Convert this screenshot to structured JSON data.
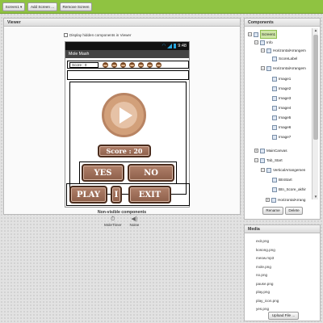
{
  "toolbar": {
    "screen_select": "Screen1 ▾",
    "add_screen": "Add Screen ...",
    "remove_screen": "Remove Screen"
  },
  "viewer": {
    "title": "Viewer",
    "checkbox_label": "Display hidden components in Viewer",
    "checkbox_checked": false,
    "phone": {
      "clock": "9:48",
      "app_title": "Mole Mash",
      "score_small": "Score : 0",
      "score_button": "Score : 20",
      "yes": "YES",
      "no": "NO",
      "play": "PLAY",
      "mid": "I",
      "exit": "EXIT"
    },
    "nonvisible_title": "Non-visible components",
    "nonvisible": [
      {
        "name": "MoleTimer",
        "icon": "clock-icon"
      },
      {
        "name": "Noise",
        "icon": "speaker-icon"
      }
    ]
  },
  "components": {
    "title": "Components",
    "tree": [
      {
        "label": "Screen1",
        "toggle": "⊟",
        "selected": true
      },
      {
        "label": "Info",
        "toggle": "⊟"
      },
      {
        "label": "HorizontalArrangem",
        "toggle": "⊟"
      },
      {
        "label": "ScoreLabel",
        "toggle": ""
      },
      {
        "label": "HorizontalArrangem",
        "toggle": "⊟"
      },
      {
        "label": "Image1",
        "toggle": ""
      },
      {
        "label": "Image2",
        "toggle": ""
      },
      {
        "label": "Image3",
        "toggle": ""
      },
      {
        "label": "Image4",
        "toggle": ""
      },
      {
        "label": "Image5",
        "toggle": ""
      },
      {
        "label": "Image6",
        "toggle": ""
      },
      {
        "label": "Image7",
        "toggle": ""
      },
      {
        "label": "MainCanvas",
        "toggle": "⊞"
      },
      {
        "label": "Tab_Start",
        "toggle": "⊟"
      },
      {
        "label": "VerticalArrangemen",
        "toggle": "⊟"
      },
      {
        "label": "BtnStart",
        "toggle": ""
      },
      {
        "label": "Btn_Score_akhir",
        "toggle": ""
      },
      {
        "label": "HorizontalArrang",
        "toggle": "⊞"
      }
    ],
    "rename": "Rename",
    "delete": "Delete"
  },
  "media": {
    "title": "Media",
    "files": [
      "exit.png",
      "kosong.png",
      "meow.mp3",
      "mole.png",
      "no.png",
      "pause.png",
      "play.png",
      "play_icon.png",
      "yes.png"
    ],
    "upload": "Upload File ..."
  },
  "colors": {
    "toolbar": "#8fc341",
    "button_brown": "#9c6c57",
    "selected_node": "#cfe6a7"
  }
}
